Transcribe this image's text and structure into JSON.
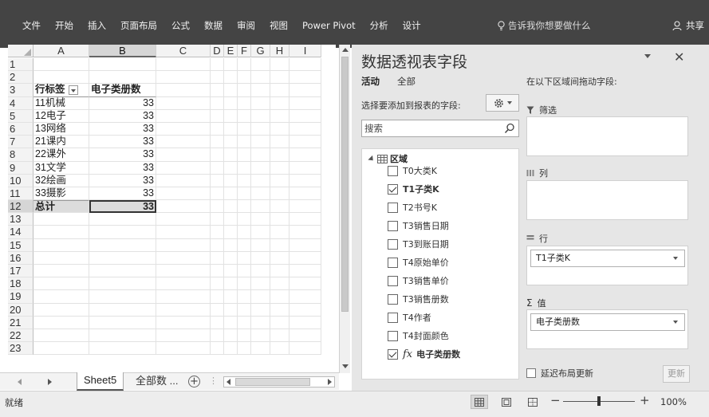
{
  "ribbon": {
    "tabs": [
      "文件",
      "开始",
      "插入",
      "页面布局",
      "公式",
      "数据",
      "审阅",
      "视图",
      "Power Pivot",
      "分析",
      "设计"
    ],
    "tell_me": "告诉我你想要做什么",
    "share": "共享"
  },
  "sheet": {
    "columns": [
      "A",
      "B",
      "C",
      "D",
      "E",
      "F",
      "G",
      "H",
      "I"
    ],
    "selected_column": "B",
    "selected_row": "12",
    "row_numbers": [
      "1",
      "2",
      "3",
      "4",
      "5",
      "6",
      "7",
      "8",
      "9",
      "10",
      "11",
      "12",
      "13",
      "14",
      "15",
      "16",
      "17",
      "18",
      "19",
      "20",
      "21",
      "22",
      "23"
    ],
    "pivot_header": {
      "row_label": "行标签",
      "value_label": "电子类册数"
    },
    "pivot_rows": [
      {
        "label": "11机械",
        "value": "33"
      },
      {
        "label": "12电子",
        "value": "33"
      },
      {
        "label": "13网络",
        "value": "33"
      },
      {
        "label": "21课内",
        "value": "33"
      },
      {
        "label": "22课外",
        "value": "33"
      },
      {
        "label": "31文学",
        "value": "33"
      },
      {
        "label": "32绘画",
        "value": "33"
      },
      {
        "label": "33摄影",
        "value": "33"
      }
    ],
    "pivot_total": {
      "label": "总计",
      "value": "33"
    }
  },
  "sheet_tabs": {
    "active": "Sheet5",
    "other": "全部数 ...",
    "add": "+"
  },
  "pivot_pane": {
    "title": "数据透视表字段",
    "tab_active": "活动",
    "tab_all": "全部",
    "choose_label": "选择要添加到报表的字段:",
    "search_placeholder": "搜索",
    "table_name": "区域",
    "fields": [
      {
        "name": "T0大类K",
        "checked": false
      },
      {
        "name": "T1子类K",
        "checked": true
      },
      {
        "name": "T2书号K",
        "checked": false
      },
      {
        "name": "T3销售日期",
        "checked": false
      },
      {
        "name": "T3到账日期",
        "checked": false
      },
      {
        "name": "T4原始单价",
        "checked": false
      },
      {
        "name": "T3销售单价",
        "checked": false
      },
      {
        "name": "T3销售册数",
        "checked": false
      },
      {
        "name": "T4作者",
        "checked": false
      },
      {
        "name": "T4封面颜色",
        "checked": false
      },
      {
        "name": "电子类册数",
        "checked": true,
        "calculated": true
      }
    ],
    "fx_symbol": "fx",
    "drag_label": "在以下区域间拖动字段:",
    "areas": {
      "filter": {
        "label": "筛选",
        "items": []
      },
      "columns": {
        "label": "列",
        "items": []
      },
      "rows": {
        "label": "行",
        "items": [
          "T1子类K"
        ]
      },
      "values": {
        "label": "值",
        "symbol": "Σ",
        "items": [
          "电子类册数"
        ]
      }
    },
    "defer_label": "延迟布局更新",
    "update_label": "更新"
  },
  "status": {
    "ready": "就绪",
    "zoom": "100%",
    "minus": "−",
    "plus": "+"
  },
  "icons": {
    "tell_me": "lightbulb-icon",
    "share": "person-icon",
    "settings": "gear-icon",
    "search": "search-icon",
    "table": "table-icon",
    "filter": "funnel-icon",
    "columns": "columns-icon",
    "rows": "rows-icon",
    "close": "close-icon"
  }
}
